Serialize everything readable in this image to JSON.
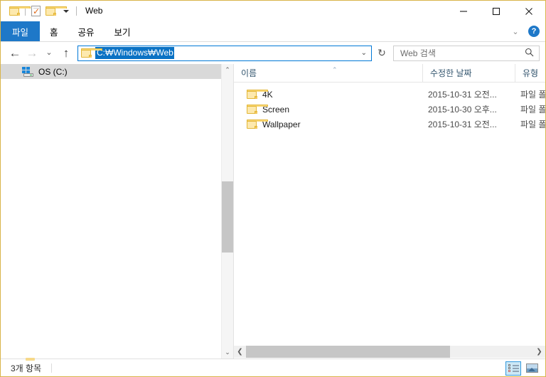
{
  "window": {
    "title": "Web",
    "border_color": "#d9b44a",
    "accent_color": "#1e78c8",
    "selection_color": "#0b72c4"
  },
  "quick_access": {
    "items": [
      {
        "name": "folder-icon",
        "label": ""
      },
      {
        "name": "properties-icon",
        "label": ""
      },
      {
        "name": "new-folder-icon",
        "label": ""
      },
      {
        "name": "customize-chevron-icon",
        "label": ""
      }
    ]
  },
  "window_controls": {
    "minimize": "minimize-button",
    "maximize": "maximize-button",
    "close": "close-button"
  },
  "ribbon": {
    "tabs": [
      {
        "label": "파일",
        "active": true
      },
      {
        "label": "홈",
        "active": false
      },
      {
        "label": "공유",
        "active": false
      },
      {
        "label": "보기",
        "active": false
      }
    ],
    "collapse_icon": "⌄",
    "help_label": "?"
  },
  "address_bar": {
    "back_glyph": "←",
    "forward_glyph": "→",
    "recent_glyph": "⌄",
    "up_glyph": "↑",
    "path": "C:₩Windows₩Web",
    "dropdown_glyph": "⌄",
    "refresh_glyph": "↻"
  },
  "search": {
    "placeholder": "Web 검색",
    "icon": "search-icon"
  },
  "nav_pane": {
    "items": [
      {
        "label": "OS (C:)",
        "icon": "drive-icon",
        "selected": true
      }
    ],
    "scroll_up_glyph": "⌃",
    "scroll_down_glyph": "⌄"
  },
  "file_list": {
    "columns": [
      {
        "label": "이름",
        "sorted": "asc",
        "sort_glyph": "⌃"
      },
      {
        "label": "수정한 날짜",
        "sorted": ""
      },
      {
        "label": "유형",
        "sorted": ""
      }
    ],
    "rows": [
      {
        "name": "4K",
        "date": "2015-10-31 오전...",
        "type": "파일 폴",
        "icon": "folder-icon"
      },
      {
        "name": "Screen",
        "date": "2015-10-30 오후...",
        "type": "파일 폴",
        "icon": "folder-icon"
      },
      {
        "name": "Wallpaper",
        "date": "2015-10-31 오전...",
        "type": "파일 폴",
        "icon": "folder-icon"
      }
    ],
    "hscroll_left_glyph": "❮",
    "hscroll_right_glyph": "❯"
  },
  "status_bar": {
    "item_count": "3개 항목",
    "views": [
      {
        "name": "details-view-button",
        "active": true
      },
      {
        "name": "large-icons-view-button",
        "active": false
      }
    ]
  }
}
